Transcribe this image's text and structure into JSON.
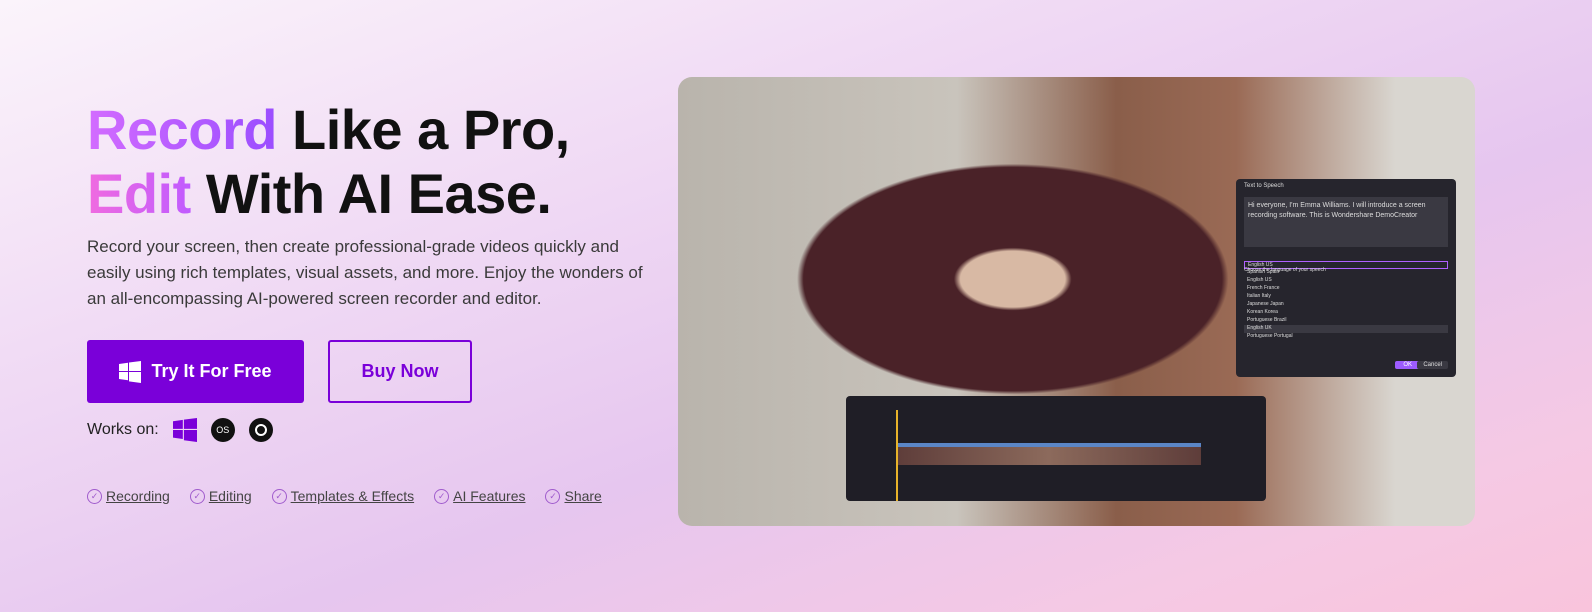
{
  "hero": {
    "title_accent1": "Record",
    "title_rest1": " Like a Pro,",
    "title_accent2": "Edit",
    "title_rest2": " With AI Ease.",
    "description": "Record your screen, then create professional-grade videos quickly and easily using rich templates, visual assets, and more. Enjoy the wonders of an all-encompassing AI-powered screen recorder and editor.",
    "try_label": "Try It For Free",
    "buy_label": "Buy Now",
    "works_on": "Works on:",
    "macos_label": "OS"
  },
  "features": [
    "Recording",
    "Editing",
    "Templates & Effects",
    "AI Features",
    "Share"
  ],
  "dialog": {
    "title": "Text to Speech",
    "text": "Hi everyone, I'm Emma Williams. I will introduce a screen recording software. This is Wondershare DemoCreator",
    "prompt": "Choose the language of your speech",
    "selected": "English US",
    "options": [
      "Spanish Spain",
      "English US",
      "French France",
      "Italian Italy",
      "Japanese Japan",
      "Korean Korea",
      "Portuguese Brazil",
      "English UK",
      "Portuguese Portugal"
    ],
    "ok": "OK",
    "cancel": "Cancel"
  },
  "colors": {
    "accent": "#7a00d9"
  }
}
